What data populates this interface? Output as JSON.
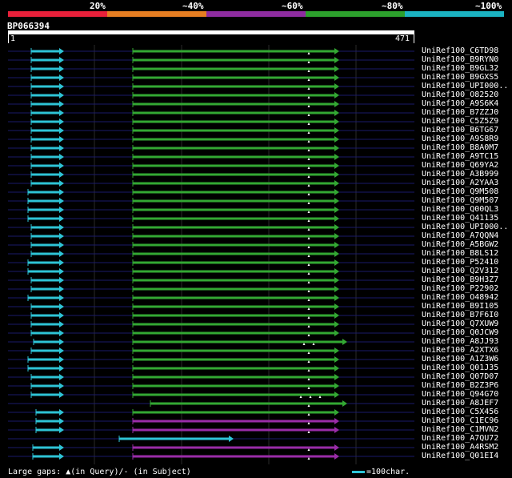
{
  "legend": {
    "labels": [
      "20%",
      "~40%",
      "~60%",
      "~80%",
      "~100%"
    ],
    "colors": [
      "#e8203a",
      "#e67e22",
      "#8e2ca0",
      "#2ca02c",
      "#1bb3c2"
    ]
  },
  "query": {
    "name": "BP066394",
    "start": "1",
    "end": "471"
  },
  "footer": {
    "gaps_text": "Large gaps: ▲(in Query)/- (in Subject)",
    "scale_text": "=100char."
  },
  "colors": {
    "cyan": "#2ec4d6",
    "green": "#33a833",
    "purple": "#9a2ca8",
    "gap_marker": "#ffffff"
  },
  "hits": [
    {
      "label": "UniRef100_C6TD98",
      "s1": [
        39,
        74
      ],
      "s2": [
        166,
        418
      ],
      "color": "green",
      "marks": [
        386
      ]
    },
    {
      "label": "UniRef100_B9RYN0",
      "s1": [
        39,
        74
      ],
      "s2": [
        166,
        418
      ],
      "color": "green",
      "marks": [
        386
      ]
    },
    {
      "label": "UniRef100_B9GL32",
      "s1": [
        39,
        74
      ],
      "s2": [
        166,
        418
      ],
      "color": "green",
      "marks": [
        386
      ]
    },
    {
      "label": "UniRef100_B9GXS5",
      "s1": [
        39,
        74
      ],
      "s2": [
        166,
        418
      ],
      "color": "green",
      "marks": [
        386
      ]
    },
    {
      "label": "UniRef100_UPI000..",
      "s1": [
        39,
        74
      ],
      "s2": [
        166,
        418
      ],
      "color": "green",
      "marks": [
        386
      ]
    },
    {
      "label": "UniRef100_O82520",
      "s1": [
        39,
        74
      ],
      "s2": [
        166,
        418
      ],
      "color": "green",
      "marks": [
        386
      ]
    },
    {
      "label": "UniRef100_A9S6K4",
      "s1": [
        39,
        74
      ],
      "s2": [
        166,
        418
      ],
      "color": "green",
      "marks": [
        386
      ]
    },
    {
      "label": "UniRef100_B7ZZJ0",
      "s1": [
        39,
        74
      ],
      "s2": [
        166,
        418
      ],
      "color": "green",
      "marks": [
        386
      ]
    },
    {
      "label": "UniRef100_C5Z5Z9",
      "s1": [
        39,
        74
      ],
      "s2": [
        166,
        418
      ],
      "color": "green",
      "marks": [
        386
      ]
    },
    {
      "label": "UniRef100_B6TG67",
      "s1": [
        39,
        74
      ],
      "s2": [
        166,
        418
      ],
      "color": "green",
      "marks": [
        386
      ]
    },
    {
      "label": "UniRef100_A9S8R9",
      "s1": [
        39,
        74
      ],
      "s2": [
        166,
        418
      ],
      "color": "green",
      "marks": [
        386
      ]
    },
    {
      "label": "UniRef100_B8A0M7",
      "s1": [
        39,
        74
      ],
      "s2": [
        166,
        418
      ],
      "color": "green",
      "marks": [
        386
      ]
    },
    {
      "label": "UniRef100_A9TC15",
      "s1": [
        39,
        74
      ],
      "s2": [
        166,
        418
      ],
      "color": "green",
      "marks": [
        386
      ]
    },
    {
      "label": "UniRef100_Q69YA2",
      "s1": [
        39,
        74
      ],
      "s2": [
        166,
        418
      ],
      "color": "green",
      "marks": [
        386
      ]
    },
    {
      "label": "UniRef100_A3B999",
      "s1": [
        39,
        74
      ],
      "s2": [
        166,
        418
      ],
      "color": "green",
      "marks": [
        386
      ]
    },
    {
      "label": "UniRef100_A2YAA3",
      "s1": [
        39,
        74
      ],
      "s2": [
        166,
        418
      ],
      "color": "green",
      "marks": [
        386
      ]
    },
    {
      "label": "UniRef100_Q9M508",
      "s1": [
        35,
        74
      ],
      "s2": [
        166,
        418
      ],
      "color": "green",
      "marks": [
        386
      ]
    },
    {
      "label": "UniRef100_Q9M507",
      "s1": [
        35,
        74
      ],
      "s2": [
        166,
        418
      ],
      "color": "green",
      "marks": [
        386
      ]
    },
    {
      "label": "UniRef100_Q00QL3",
      "s1": [
        35,
        74
      ],
      "s2": [
        166,
        418
      ],
      "color": "green",
      "marks": [
        386
      ]
    },
    {
      "label": "UniRef100_Q41135",
      "s1": [
        35,
        74
      ],
      "s2": [
        166,
        418
      ],
      "color": "green",
      "marks": [
        386
      ]
    },
    {
      "label": "UniRef100_UPI000..",
      "s1": [
        39,
        74
      ],
      "s2": [
        166,
        418
      ],
      "color": "green",
      "marks": [
        386
      ]
    },
    {
      "label": "UniRef100_A7QQN4",
      "s1": [
        39,
        74
      ],
      "s2": [
        166,
        418
      ],
      "color": "green",
      "marks": [
        386
      ]
    },
    {
      "label": "UniRef100_A5BGW2",
      "s1": [
        39,
        74
      ],
      "s2": [
        166,
        418
      ],
      "color": "green",
      "marks": [
        386
      ]
    },
    {
      "label": "UniRef100_B8LS12",
      "s1": [
        39,
        74
      ],
      "s2": [
        166,
        418
      ],
      "color": "green",
      "marks": [
        386
      ]
    },
    {
      "label": "UniRef100_P52410",
      "s1": [
        35,
        74
      ],
      "s2": [
        166,
        418
      ],
      "color": "green",
      "marks": [
        386
      ]
    },
    {
      "label": "UniRef100_Q2V312",
      "s1": [
        35,
        74
      ],
      "s2": [
        166,
        418
      ],
      "color": "green",
      "marks": [
        386
      ]
    },
    {
      "label": "UniRef100_B9H3Z7",
      "s1": [
        39,
        74
      ],
      "s2": [
        166,
        418
      ],
      "color": "green",
      "marks": [
        386
      ]
    },
    {
      "label": "UniRef100_P22902",
      "s1": [
        39,
        74
      ],
      "s2": [
        166,
        418
      ],
      "color": "green",
      "marks": [
        386
      ]
    },
    {
      "label": "UniRef100_O48942",
      "s1": [
        35,
        74
      ],
      "s2": [
        166,
        418
      ],
      "color": "green",
      "marks": [
        386
      ]
    },
    {
      "label": "UniRef100_B9I105",
      "s1": [
        39,
        74
      ],
      "s2": [
        166,
        418
      ],
      "color": "green",
      "marks": [
        386
      ]
    },
    {
      "label": "UniRef100_B7F6I0",
      "s1": [
        39,
        74
      ],
      "s2": [
        166,
        418
      ],
      "color": "green",
      "marks": [
        386
      ]
    },
    {
      "label": "UniRef100_Q7XUW9",
      "s1": [
        39,
        74
      ],
      "s2": [
        166,
        418
      ],
      "color": "green",
      "marks": [
        386
      ]
    },
    {
      "label": "UniRef100_Q0JCW9",
      "s1": [
        39,
        74
      ],
      "s2": [
        166,
        418
      ],
      "color": "green",
      "marks": [
        386
      ]
    },
    {
      "label": "UniRef100_A8JJ93",
      "s1": [
        42,
        74
      ],
      "s2": [
        166,
        428
      ],
      "color": "green",
      "marks": [
        380,
        392
      ]
    },
    {
      "label": "UniRef100_A2XTX6",
      "s1": [
        39,
        74
      ],
      "s2": [
        166,
        418
      ],
      "color": "green",
      "marks": [
        386
      ]
    },
    {
      "label": "UniRef100_A1Z3W6",
      "s1": [
        35,
        74
      ],
      "s2": [
        166,
        418
      ],
      "color": "green",
      "marks": [
        386
      ]
    },
    {
      "label": "UniRef100_Q01J35",
      "s1": [
        35,
        74
      ],
      "s2": [
        166,
        418
      ],
      "color": "green",
      "marks": [
        386
      ]
    },
    {
      "label": "UniRef100_Q07D07",
      "s1": [
        39,
        74
      ],
      "s2": [
        166,
        418
      ],
      "color": "green",
      "marks": [
        386
      ]
    },
    {
      "label": "UniRef100_B2Z3P6",
      "s1": [
        39,
        74
      ],
      "s2": [
        166,
        418
      ],
      "color": "green",
      "marks": [
        386
      ]
    },
    {
      "label": "UniRef100_Q94G70",
      "s1": [
        39,
        74
      ],
      "s2": [
        166,
        418
      ],
      "color": "green",
      "marks": [
        376,
        388,
        400
      ]
    },
    {
      "label": "UniRef100_A8JEF7",
      "s1": null,
      "s2": [
        188,
        428
      ],
      "color": "green",
      "marks": [
        386
      ]
    },
    {
      "label": "UniRef100_C5X456",
      "s1": [
        45,
        74
      ],
      "s2": [
        166,
        418
      ],
      "color": "green",
      "marks": [
        386
      ]
    },
    {
      "label": "UniRef100_C1EC96",
      "s1": [
        45,
        74
      ],
      "s2": [
        166,
        418
      ],
      "color": "purple",
      "marks": [
        386
      ]
    },
    {
      "label": "UniRef100_C1MVN2",
      "s1": [
        45,
        74
      ],
      "s2": [
        166,
        418
      ],
      "color": "purple",
      "marks": [
        386
      ]
    },
    {
      "label": "UniRef100_A7QU72",
      "s1": [
        149,
        286
      ],
      "s2": null,
      "color": "cyan",
      "marks": []
    },
    {
      "label": "UniRef100_A4RSM2",
      "s1": [
        41,
        74
      ],
      "s2": [
        166,
        418
      ],
      "color": "purple",
      "marks": [
        386
      ]
    },
    {
      "label": "UniRef100_Q01EI4",
      "s1": [
        41,
        74
      ],
      "s2": [
        166,
        418
      ],
      "color": "purple",
      "marks": [
        386
      ]
    }
  ]
}
